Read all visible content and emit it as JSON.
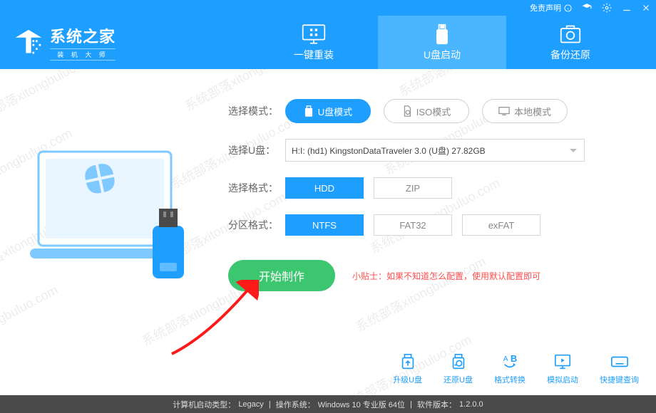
{
  "titlebar": {
    "disclaimer": "免责声明"
  },
  "brand": {
    "title": "系统之家",
    "sub": "装 机 大 师"
  },
  "tabs": [
    {
      "label": "一键重装"
    },
    {
      "label": "U盘启动"
    },
    {
      "label": "备份还原"
    }
  ],
  "panel": {
    "mode_label": "选择模式：",
    "modes": {
      "usb": "U盘模式",
      "iso": "ISO模式",
      "local": "本地模式"
    },
    "disk_label": "选择U盘：",
    "disk_value": "H:I: (hd1) KingstonDataTraveler 3.0 (U盘) 27.82GB",
    "format_label": "选择格式：",
    "formats": {
      "hdd": "HDD",
      "zip": "ZIP"
    },
    "partition_label": "分区格式：",
    "partitions": {
      "ntfs": "NTFS",
      "fat32": "FAT32",
      "exfat": "exFAT"
    },
    "start": "开始制作",
    "tip_prefix": "小贴士：",
    "tip_text": "如果不知道怎么配置，使用默认配置即可"
  },
  "tools": [
    {
      "label": "升级U盘"
    },
    {
      "label": "还原U盘"
    },
    {
      "label": "格式转换"
    },
    {
      "label": "模拟启动"
    },
    {
      "label": "快捷键查询"
    }
  ],
  "status": {
    "boot_type_label": "计算机启动类型：",
    "boot_type": "Legacy",
    "os_label": "操作系统：",
    "os": "Windows 10 专业版 64位",
    "ver_label": "软件版本：",
    "ver": "1.2.0.0"
  },
  "watermark": "系统部落xitongbuluo.com"
}
